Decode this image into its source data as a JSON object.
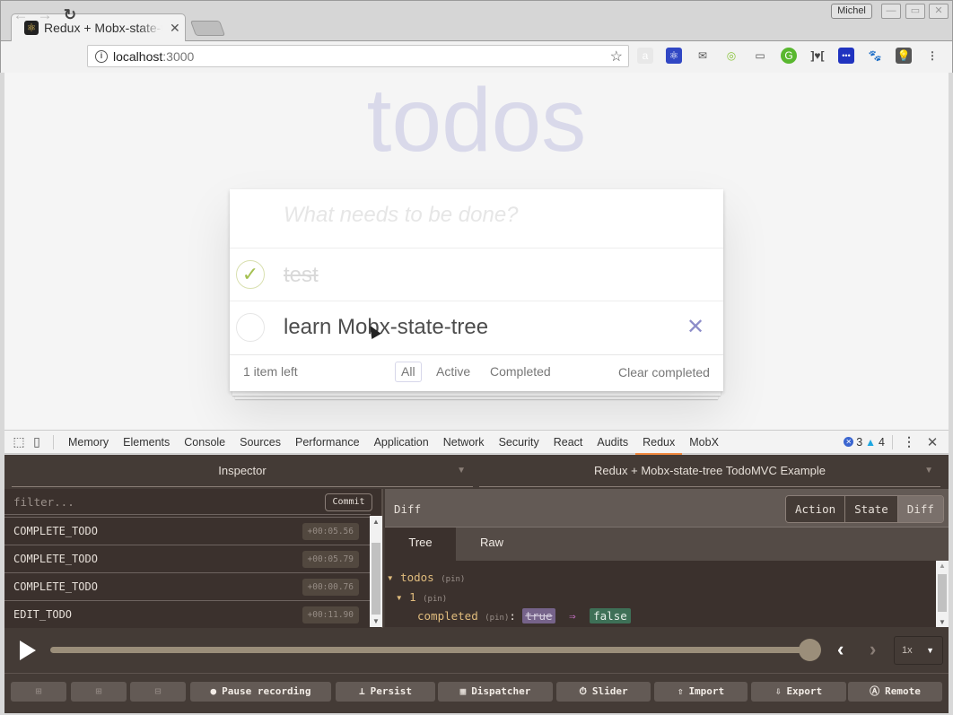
{
  "browser": {
    "tab_title": "Redux + Mobx-state-tree TodoMVC Example",
    "tab_favicon": "react-atom-icon",
    "profile_name": "Michel",
    "url_host": "localhost",
    "url_port": ":3000",
    "extensions": [
      "extension-a-icon",
      "redux-devtools-icon",
      "mailbox-icon",
      "radar-icon",
      "cast-icon",
      "grammarly-icon",
      "code-brackets-icon",
      "lastpass-icon",
      "gnome-icon",
      "lightbulb-icon"
    ]
  },
  "app": {
    "title": "todos",
    "new_todo_placeholder": "What needs to be done?",
    "todos": [
      {
        "text": "test",
        "completed": true
      },
      {
        "text": "learn Mobx-state-tree",
        "completed": false
      }
    ],
    "items_left": "1 item left",
    "filters": [
      "All",
      "Active",
      "Completed"
    ],
    "selected_filter": "All",
    "clear_completed": "Clear completed",
    "check_glyph": "✓",
    "destroy_glyph": "✕"
  },
  "devtools": {
    "tabs": [
      "Memory",
      "Elements",
      "Console",
      "Sources",
      "Performance",
      "Application",
      "Network",
      "Security",
      "React",
      "Audits",
      "Redux",
      "MobX"
    ],
    "selected_tab": "Redux",
    "error_count": "3",
    "warning_count": "4"
  },
  "redux": {
    "monitor": "Inspector",
    "instance": "Redux + Mobx-state-tree TodoMVC Example",
    "filter_placeholder": "filter...",
    "commit_label": "Commit",
    "actions": [
      {
        "name": "COMPLETE_TODO",
        "time": "+00:05.56"
      },
      {
        "name": "COMPLETE_TODO",
        "time": "+00:05.79"
      },
      {
        "name": "COMPLETE_TODO",
        "time": "+00:00.76"
      },
      {
        "name": "EDIT_TODO",
        "time": "+00:11.90"
      }
    ],
    "panel_title": "Diff",
    "view_buttons": [
      "Action",
      "State",
      "Diff"
    ],
    "selected_view": "Diff",
    "subtabs": [
      "Tree",
      "Raw"
    ],
    "selected_subtab": "Tree",
    "diff": {
      "root_key": "todos",
      "child_key": "1",
      "field_key": "completed",
      "pin_label": "(pin)",
      "old_value": "true",
      "new_value": "false",
      "arrow": "⇒"
    },
    "slider_position": 1.0,
    "speed": "1x",
    "bottom_buttons": [
      {
        "label": "",
        "icon": "layout-left-icon"
      },
      {
        "label": "",
        "icon": "layout-right-icon"
      },
      {
        "label": "",
        "icon": "layout-bottom-icon"
      },
      {
        "label": "Pause recording",
        "icon": "record-icon",
        "glyph": "●"
      },
      {
        "label": "Persist",
        "icon": "pin-icon",
        "glyph": "📌"
      },
      {
        "label": "Dispatcher",
        "icon": "keyboard-icon",
        "glyph": "▦"
      },
      {
        "label": "Slider",
        "icon": "timer-icon",
        "glyph": "⏱"
      },
      {
        "label": "Import",
        "icon": "upload-icon",
        "glyph": "⭱"
      },
      {
        "label": "Export",
        "icon": "download-icon",
        "glyph": "⭳"
      },
      {
        "label": "Remote",
        "icon": "antenna-icon",
        "glyph": "📡"
      }
    ]
  }
}
